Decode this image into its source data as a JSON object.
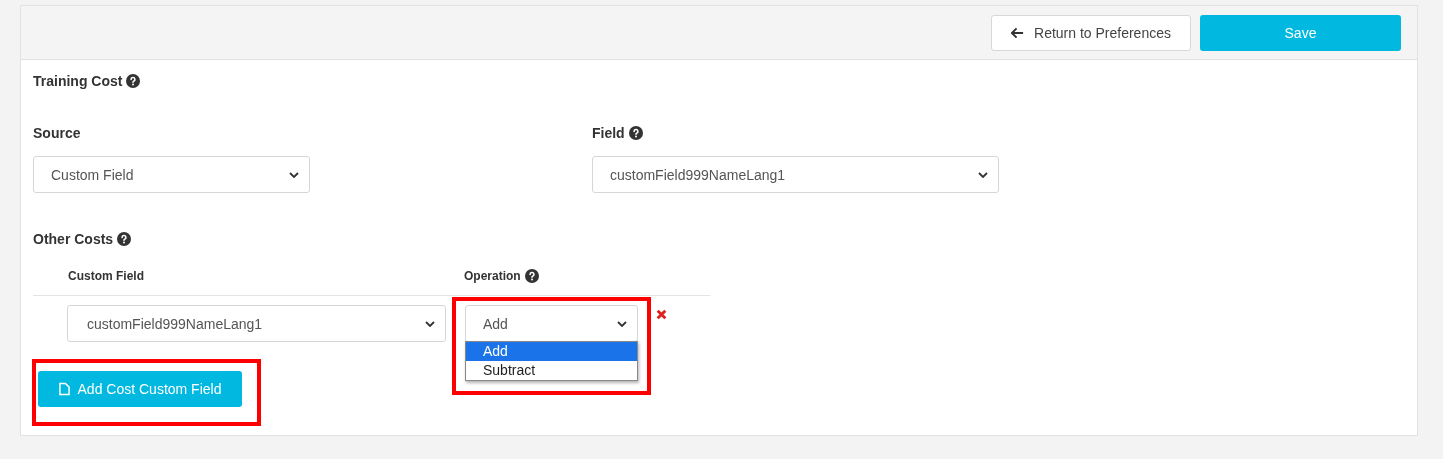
{
  "header": {
    "buttons": [
      {
        "kind": "back",
        "label": "Return to Preferences"
      },
      {
        "kind": "primary",
        "label": "Save"
      }
    ]
  },
  "training_cost": {
    "title": "Training Cost",
    "source": {
      "label": "Source",
      "value": "Custom Field"
    },
    "field": {
      "label": "Field",
      "value": "customField999NameLang1"
    }
  },
  "other_costs": {
    "title": "Other Costs",
    "columns": [
      {
        "label": "Custom Field",
        "help": false
      },
      {
        "label": "Operation",
        "help": true
      }
    ],
    "rows": [
      {
        "custom_field": "customField999NameLang1",
        "operation": "Add",
        "highlighted": true,
        "expanded": true,
        "options": [
          {
            "label": "Add",
            "selected": true
          },
          {
            "label": "Subtract",
            "selected": false
          }
        ]
      }
    ],
    "add_button": {
      "label": "Add Cost Custom Field",
      "highlighted": true
    }
  }
}
